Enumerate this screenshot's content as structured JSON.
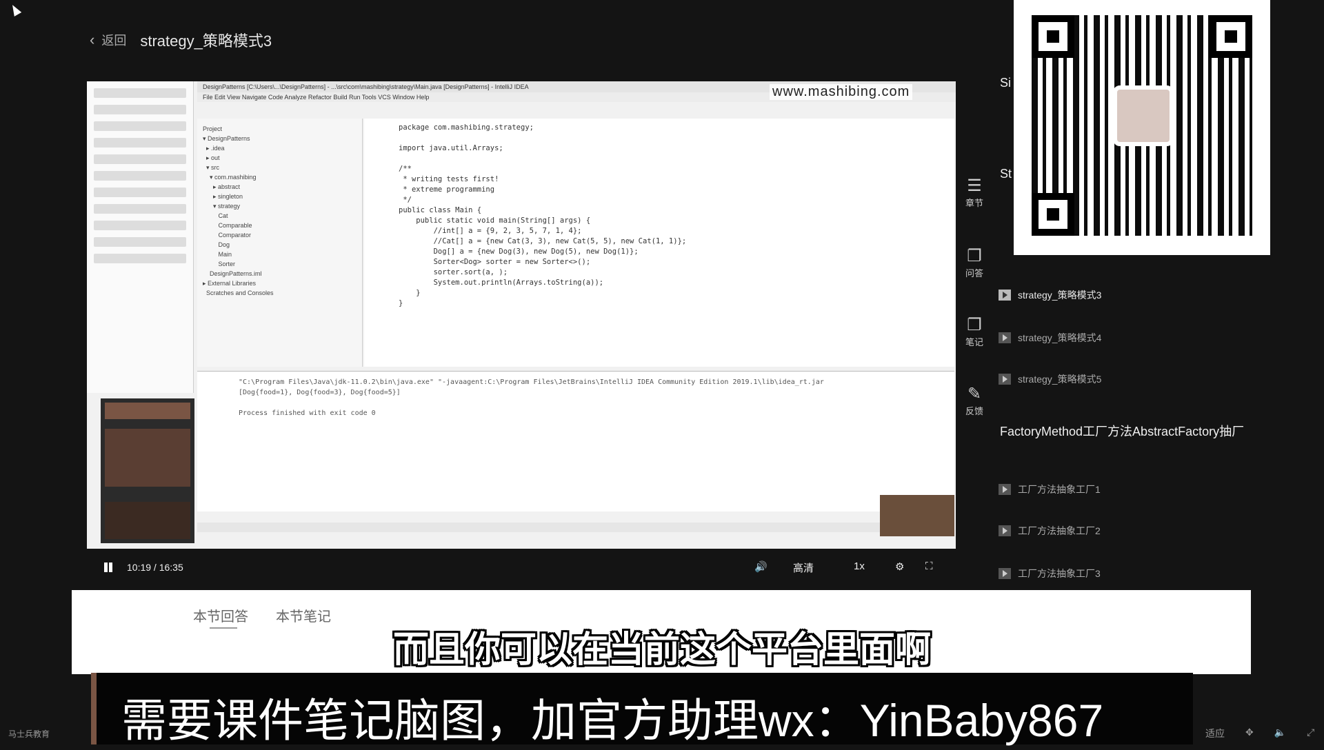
{
  "header": {
    "back_label": "返回",
    "title": "strategy_策略模式3"
  },
  "video": {
    "watermark": "www.mashibing.com",
    "ide_title": "DesignPatterns [C:\\Users\\...\\DesignPatterns] - ...\\src\\com\\mashibing\\strategy\\Main.java [DesignPatterns] - IntelliJ IDEA",
    "ide_menu": "File  Edit  View  Navigate  Code  Analyze  Refactor  Build  Run  Tools  VCS  Window  Help",
    "project_tree": "Project\n▾ DesignPatterns\n  ▸ .idea\n  ▸ out\n  ▾ src\n    ▾ com.mashibing\n      ▸ abstract\n      ▸ singleton\n      ▾ strategy\n         Cat\n         Comparable\n         Comparator\n         Dog\n         Main\n         Sorter\n    DesignPatterns.iml\n▸ External Libraries\n  Scratches and Consoles",
    "code": "package com.mashibing.strategy;\n\nimport java.util.Arrays;\n\n/**\n * writing tests first!\n * extreme programming\n */\npublic class Main {\n    public static void main(String[] args) {\n        //int[] a = {9, 2, 3, 5, 7, 1, 4};\n        //Cat[] a = {new Cat(3, 3), new Cat(5, 5), new Cat(1, 1)};\n        Dog[] a = {new Dog(3), new Dog(5), new Dog(1)};\n        Sorter<Dog> sorter = new Sorter<>();\n        sorter.sort(a, );\n        System.out.println(Arrays.toString(a));\n    }\n}",
    "console": "\"C:\\Program Files\\Java\\jdk-11.0.2\\bin\\java.exe\" \"-javaagent:C:\\Program Files\\JetBrains\\IntelliJ IDEA Community Edition 2019.1\\lib\\idea_rt.jar\n[Dog{food=1}, Dog{food=3}, Dog{food=5}]\n\nProcess finished with exit code 0",
    "time": "10:19 / 16:35",
    "quality": "高清",
    "speed": "1x"
  },
  "rail": [
    {
      "icon": "chapter-icon",
      "label": "章节"
    },
    {
      "icon": "qa-icon",
      "label": "问答"
    },
    {
      "icon": "note-icon",
      "label": "笔记"
    },
    {
      "icon": "feedback-icon",
      "label": "反馈"
    }
  ],
  "chapter_list": {
    "cut_labels": [
      "Si",
      "St"
    ],
    "items": [
      {
        "label": "strategy_策略模式3",
        "active": true
      },
      {
        "label": "strategy_策略模式4",
        "active": false
      },
      {
        "label": "strategy_策略模式5",
        "active": false
      }
    ],
    "section_title": "FactoryMethod工厂方法AbstractFactory抽厂",
    "section_items": [
      "工厂方法抽象工厂1",
      "工厂方法抽象工厂2",
      "工厂方法抽象工厂3"
    ]
  },
  "bottom_tabs": [
    "本节回答",
    "本节笔记"
  ],
  "subtitle": "而且你可以在当前这个平台里面啊",
  "banner": "需要课件笔记脑图，加官方助理wx：YinBaby867",
  "corner_left": "马士兵教育",
  "corner_right": [
    "适应"
  ]
}
